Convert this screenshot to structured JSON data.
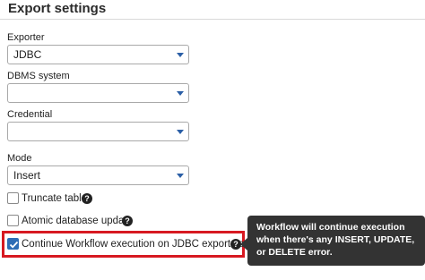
{
  "panel": {
    "title": "Export settings"
  },
  "exporter": {
    "label": "Exporter",
    "value": "JDBC"
  },
  "dbms": {
    "label": "DBMS system",
    "value": ""
  },
  "credential": {
    "label": "Credential",
    "value": ""
  },
  "mode": {
    "label": "Mode",
    "value": "Insert"
  },
  "options": [
    {
      "label": "Truncate table",
      "checked": false
    },
    {
      "label": "Atomic database update",
      "checked": false
    },
    {
      "label": "Continue Workflow execution on JDBC exports error",
      "checked": true
    }
  ],
  "help_glyph": "?",
  "tooltip": {
    "text": "Workflow will continue execution when there's any INSERT, UPDATE, or DELETE error."
  },
  "colors": {
    "accent": "#2f6db5",
    "highlight": "#d71921",
    "tooltip_bg": "#333333"
  }
}
